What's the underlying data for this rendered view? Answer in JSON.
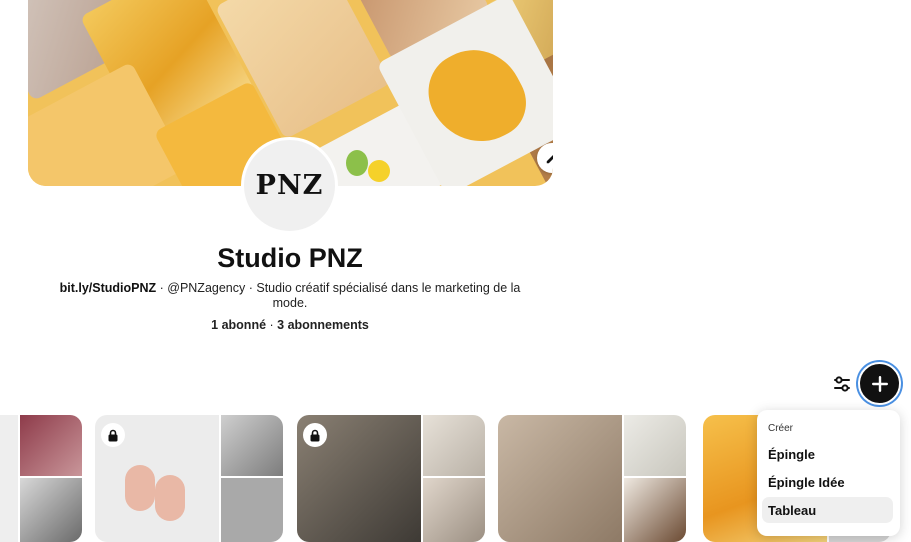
{
  "profile": {
    "avatar_text": "PNZ",
    "name": "Studio PNZ",
    "link": "bit.ly/StudioPNZ",
    "bio_rest": " · @PNZagency · Studio créatif spécialisé dans le marketing de la mode.",
    "followers": "1 abonné",
    "separator": " · ",
    "following": "3 abonnements"
  },
  "toolbar": {
    "filter_icon": "sliders-icon",
    "add_icon": "plus-icon"
  },
  "boards": [
    {
      "private": false
    },
    {
      "private": true
    },
    {
      "private": true
    },
    {
      "private": false
    },
    {
      "private": false
    }
  ],
  "create_menu": {
    "title": "Créer",
    "items": [
      "Épingle",
      "Épingle Idée",
      "Tableau"
    ],
    "highlighted": "Tableau"
  },
  "colors": {
    "accent": "#111111",
    "focus_ring": "#4a90e2"
  }
}
